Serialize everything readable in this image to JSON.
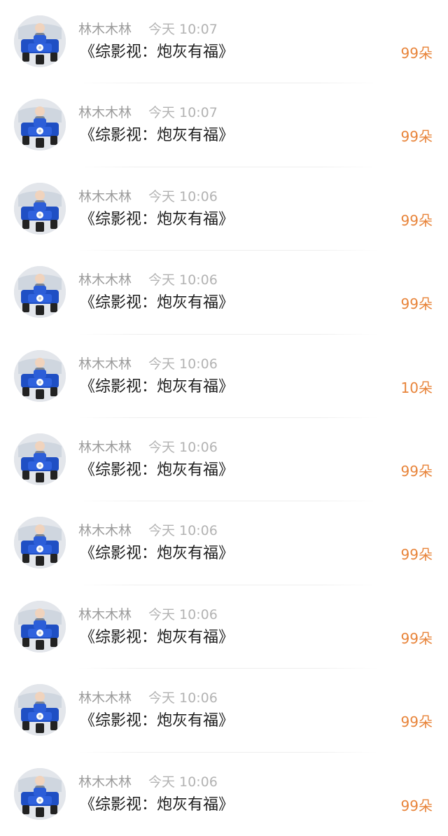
{
  "messages": [
    {
      "name": "林木木林",
      "time": "今天 10:07",
      "title": "《综影视：炮灰有福》",
      "count": "99朵"
    },
    {
      "name": "林木木林",
      "time": "今天 10:07",
      "title": "《综影视：炮灰有福》",
      "count": "99朵"
    },
    {
      "name": "林木木林",
      "time": "今天 10:06",
      "title": "《综影视：炮灰有福》",
      "count": "99朵"
    },
    {
      "name": "林木木林",
      "time": "今天 10:06",
      "title": "《综影视：炮灰有福》",
      "count": "99朵"
    },
    {
      "name": "林木木林",
      "time": "今天 10:06",
      "title": "《综影视：炮灰有福》",
      "count": "10朵"
    },
    {
      "name": "林木木林",
      "time": "今天 10:06",
      "title": "《综影视：炮灰有福》",
      "count": "99朵"
    },
    {
      "name": "林木木林",
      "time": "今天 10:06",
      "title": "《综影视：炮灰有福》",
      "count": "99朵"
    },
    {
      "name": "林木木林",
      "time": "今天 10:06",
      "title": "《综影视：炮灰有福》",
      "count": "99朵"
    },
    {
      "name": "林木木林",
      "time": "今天 10:06",
      "title": "《综影视：炮灰有福》",
      "count": "99朵"
    },
    {
      "name": "林木木林",
      "time": "今天 10:06",
      "title": "《综影视：炮灰有福》",
      "count": "99朵"
    }
  ],
  "colors": {
    "name": "#9b9b9b",
    "time": "#b3b3b3",
    "title": "#1f1f1f",
    "count_accent": "#e8843a",
    "avatar_vehicle": "#1f4fc4"
  },
  "icons": {
    "avatar": "avatar-person-on-blue-tricycle"
  }
}
